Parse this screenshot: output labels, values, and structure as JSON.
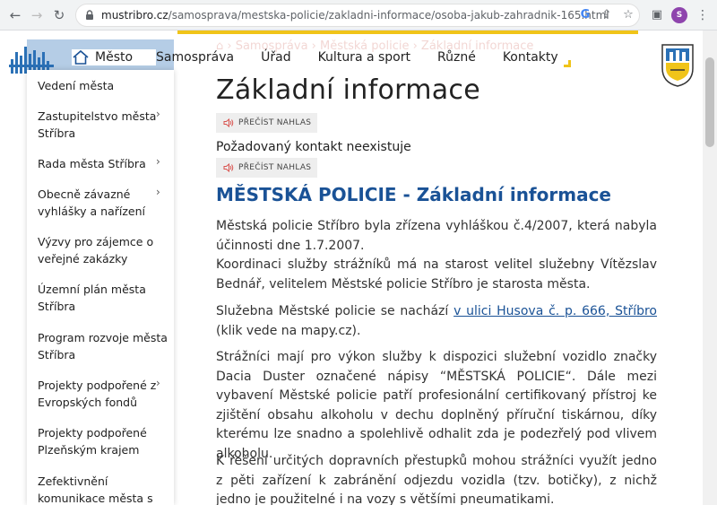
{
  "browser": {
    "url_host": "mustribro.cz",
    "url_path": "/samosprava/mestska-policie/zakladni-informace/osoba-jakub-zahradnik-165.html",
    "profile_initial": "S"
  },
  "nav": {
    "home_label": "Město",
    "items": [
      "Samospráva",
      "Úřad",
      "Kultura a sport",
      "Různé",
      "Kontakty"
    ]
  },
  "breadcrumb": "⌂ › Samospráva › Městská policie › Základní informace",
  "sidebar": {
    "items": [
      {
        "label": "Vedení města",
        "arrow": false
      },
      {
        "label": "Zastupitelstvo města Stříbra",
        "arrow": true
      },
      {
        "label": "Rada města Stříbra",
        "arrow": true
      },
      {
        "label": "Obecně závazné vyhlášky a nařízení",
        "arrow": true
      },
      {
        "label": "Výzvy pro zájemce o veřejné zakázky",
        "arrow": false
      },
      {
        "label": "Územní plán města Stříbra",
        "arrow": false
      },
      {
        "label": "Program rozvoje města Stříbra",
        "arrow": false
      },
      {
        "label": "Projekty podpořené z Evropských fondů",
        "arrow": true
      },
      {
        "label": "Projekty podpořené Plzeňským krajem",
        "arrow": false
      },
      {
        "label": "Zefektivnění komunikace města s",
        "arrow": false
      }
    ]
  },
  "content": {
    "title": "Základní informace",
    "listen_label": "PŘEČÍST NAHLAS",
    "missing_contact": "Požadovaný kontakt neexistuje",
    "section_title": "MĚSTSKÁ POLICIE - Základní informace",
    "p1": "Městská policie Stříbro byla zřízena vyhláškou č.4/2007, která nabyla účinnosti dne 1.7.2007.",
    "p1b": "Koordinaci služby strážníků má na starost velitel služebny Vítězslav Bednář, velitelem Městské policie Stříbro je starosta města.",
    "p2_before": "Služebna Městské policie se nachází ",
    "p2_link": "v ulici Husova č. p. 666, Stříbro",
    "p2_after": " (klik vede na mapy.cz).",
    "p3": "Strážníci mají pro výkon služby k dispozici služební vozidlo značky Dacia Duster označené nápisy “MĚSTSKÁ POLICIE“. Dále mezi vybavení Městské policie patří profesionální certifikovaný přístroj ke zjištění obsahu alkoholu v dechu doplněný příruční tiskárnou, díky kterému lze snadno a spolehlivě odhalit zda je podezřelý pod vlivem alkoholu.",
    "p4": "K řešení určitých dopravních přestupků mohou strážníci využít jedno z pěti zařízení k zabránění odjezdu vozidla (tzv. botičky), z nichž jedno je použitelné i na vozy s většími pneumatikami."
  },
  "colors": {
    "accent_blue": "#1a5296",
    "accent_yellow": "#f0c419"
  }
}
